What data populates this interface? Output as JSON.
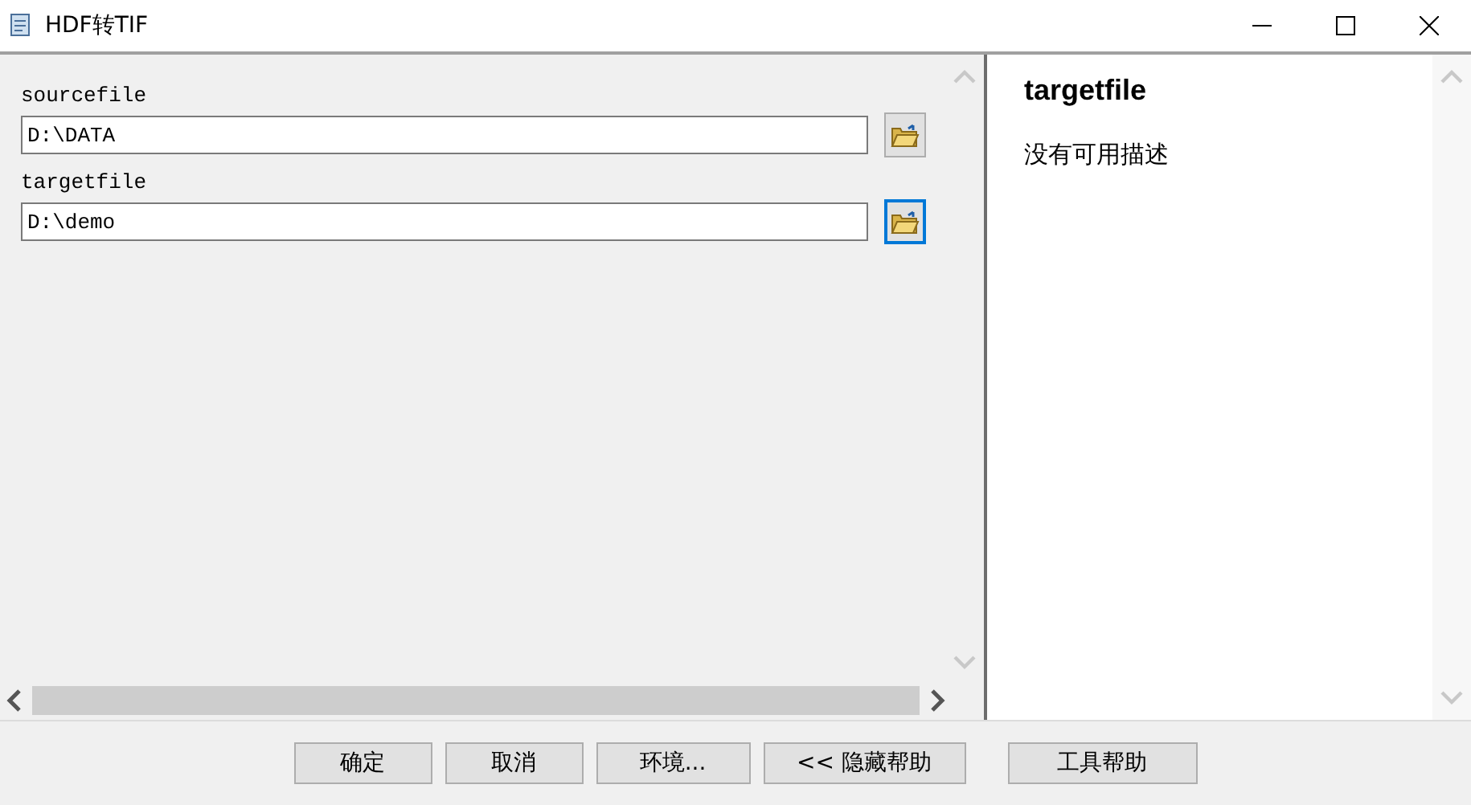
{
  "window": {
    "title": "HDF转TIF"
  },
  "fields": [
    {
      "label": "sourcefile",
      "value": "D:\\DATA",
      "browse_focused": false
    },
    {
      "label": "targetfile",
      "value": "D:\\demo",
      "browse_focused": true
    }
  ],
  "help": {
    "title": "targetfile",
    "text": "没有可用描述"
  },
  "buttons": [
    {
      "label": "确定"
    },
    {
      "label": "取消"
    },
    {
      "label": "环境..."
    },
    {
      "label": "<< 隐藏帮助"
    },
    {
      "label": "工具帮助"
    }
  ]
}
